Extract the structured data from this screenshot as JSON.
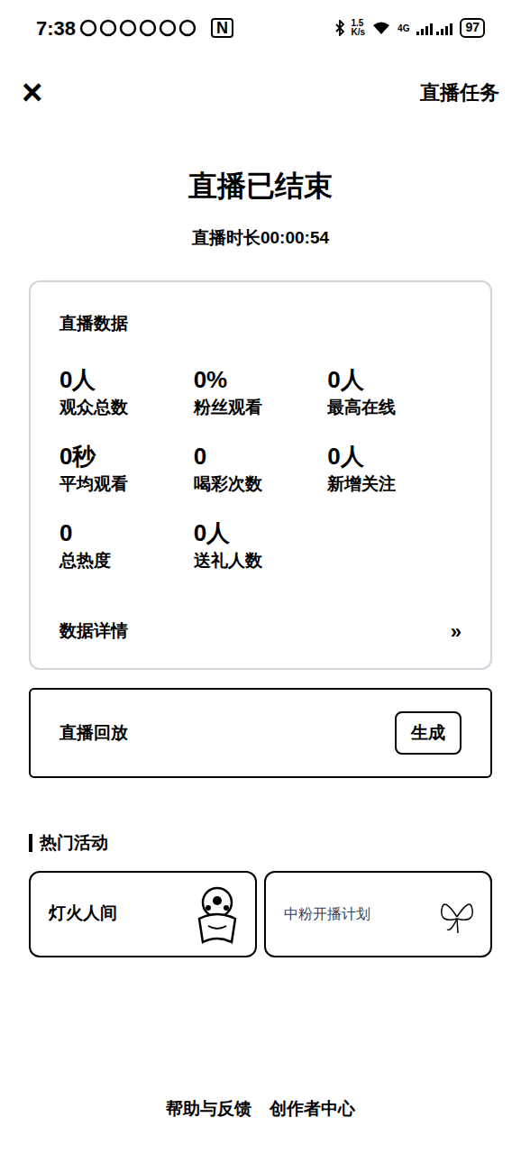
{
  "status_bar": {
    "time": "7:38",
    "nfc": "N",
    "speed": "1.5",
    "speed_unit": "K/s",
    "network": "4G",
    "battery": "97"
  },
  "header": {
    "close": "×",
    "action": "直播任务"
  },
  "title": "直播已结束",
  "duration": "直播时长00:00:54",
  "stats": {
    "title": "直播数据",
    "items": [
      {
        "value": "0人",
        "label": "观众总数"
      },
      {
        "value": "0%",
        "label": "粉丝观看"
      },
      {
        "value": "0人",
        "label": "最高在线"
      },
      {
        "value": "0秒",
        "label": "平均观看"
      },
      {
        "value": "0",
        "label": "喝彩次数"
      },
      {
        "value": "0人",
        "label": "新增关注"
      },
      {
        "value": "0",
        "label": "总热度"
      },
      {
        "value": "0人",
        "label": "送礼人数"
      }
    ],
    "details": {
      "label": "数据详情",
      "arrow": "»"
    }
  },
  "replay": {
    "label": "直播回放",
    "button": "生成"
  },
  "activities": {
    "title": "热门活动",
    "items": [
      {
        "label": "灯火人间"
      },
      {
        "label": "中粉开播计划"
      }
    ]
  },
  "footer": [
    "帮助与反馈",
    "创作者中心"
  ]
}
